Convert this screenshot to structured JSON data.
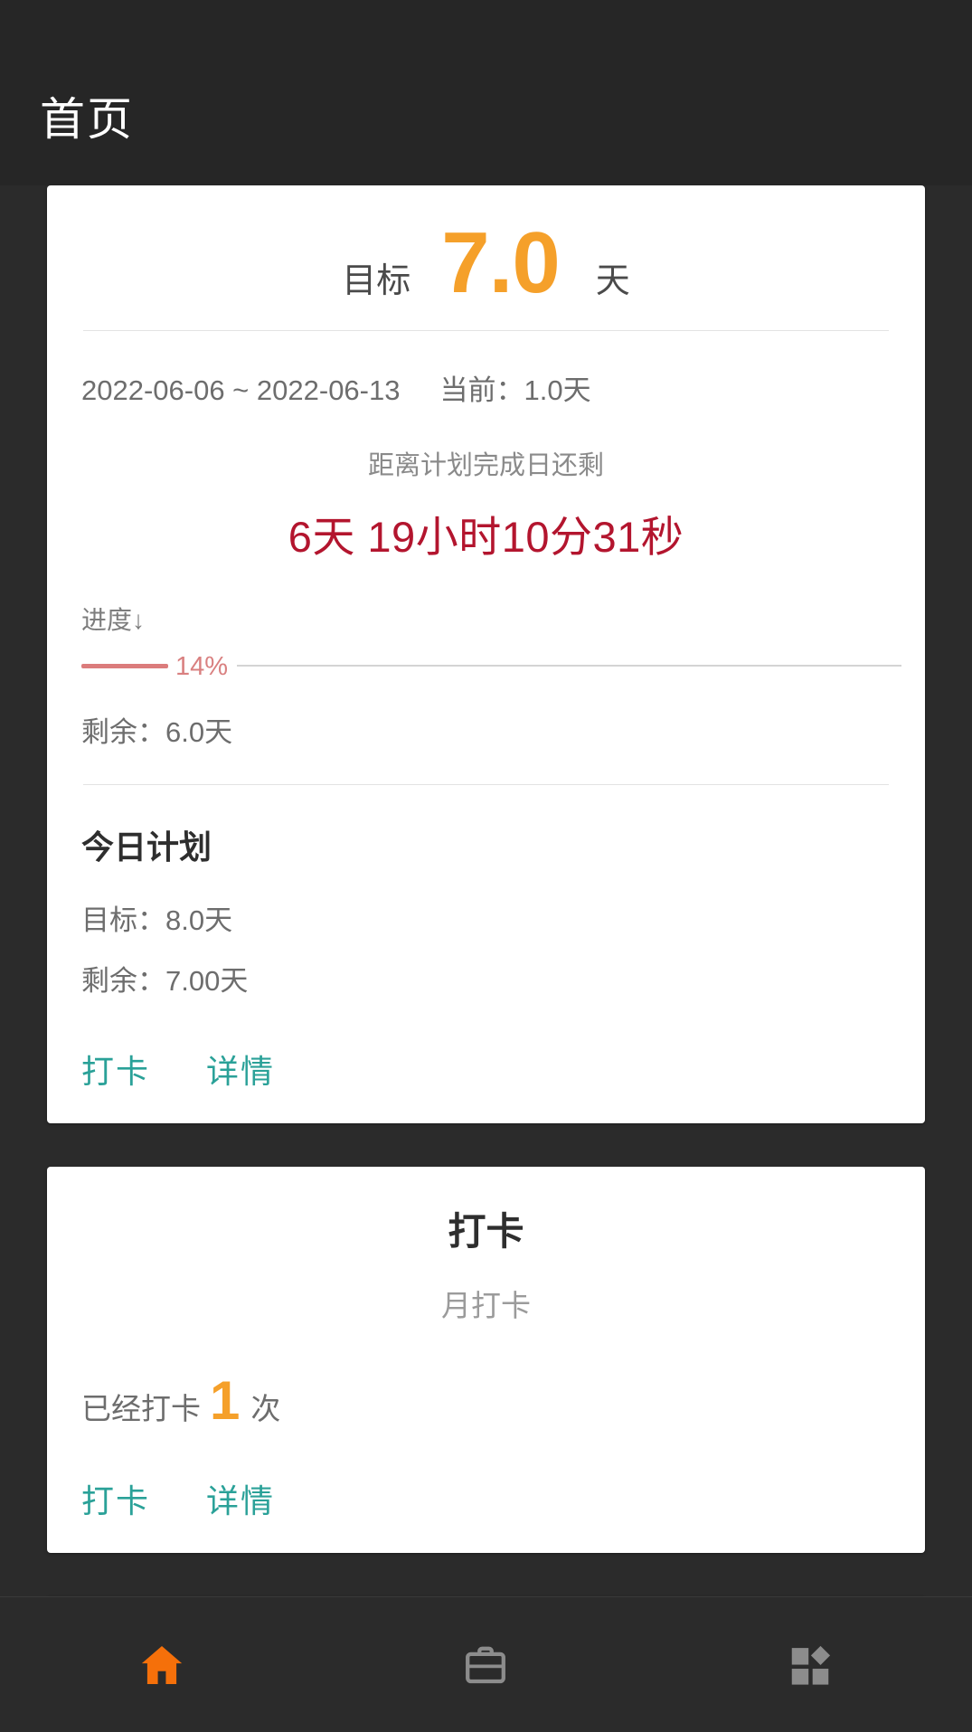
{
  "appbar": {
    "title": "首页"
  },
  "plan_card": {
    "goal_label": "目标",
    "goal_value": "7.0",
    "goal_unit": "天",
    "date_range": "2022-06-06 ~ 2022-06-13",
    "current_label": "当前：1.0天",
    "countdown_label": "距离计划完成日还剩",
    "countdown_value": "6天 19小时10分31秒",
    "progress_label": "进度↓",
    "progress_percent_text": "14%",
    "progress_percent": 14,
    "remaining_text": "剩余：6.0天",
    "today_section_title": "今日计划",
    "today_goal": "目标：8.0天",
    "today_remaining": "剩余：7.00天",
    "checkin_button": "打卡",
    "detail_button": "详情"
  },
  "checkin_card": {
    "title": "打卡",
    "subtitle": "月打卡",
    "count_prefix": "已经打卡",
    "count_value": "1",
    "count_suffix": "次",
    "checkin_button": "打卡",
    "detail_button": "详情"
  },
  "bottom_nav": {
    "items": [
      {
        "icon": "home-icon",
        "active": true
      },
      {
        "icon": "briefcase-icon",
        "active": false
      },
      {
        "icon": "dashboard-grid-icon",
        "active": false
      }
    ]
  },
  "colors": {
    "accent_orange": "#F5A02A",
    "countdown_red": "#B3152E",
    "progress_salmon": "#DB7C7C",
    "link_teal": "#2AA198",
    "background_dark": "#2B2B2B",
    "appbar_dark": "#262626"
  }
}
